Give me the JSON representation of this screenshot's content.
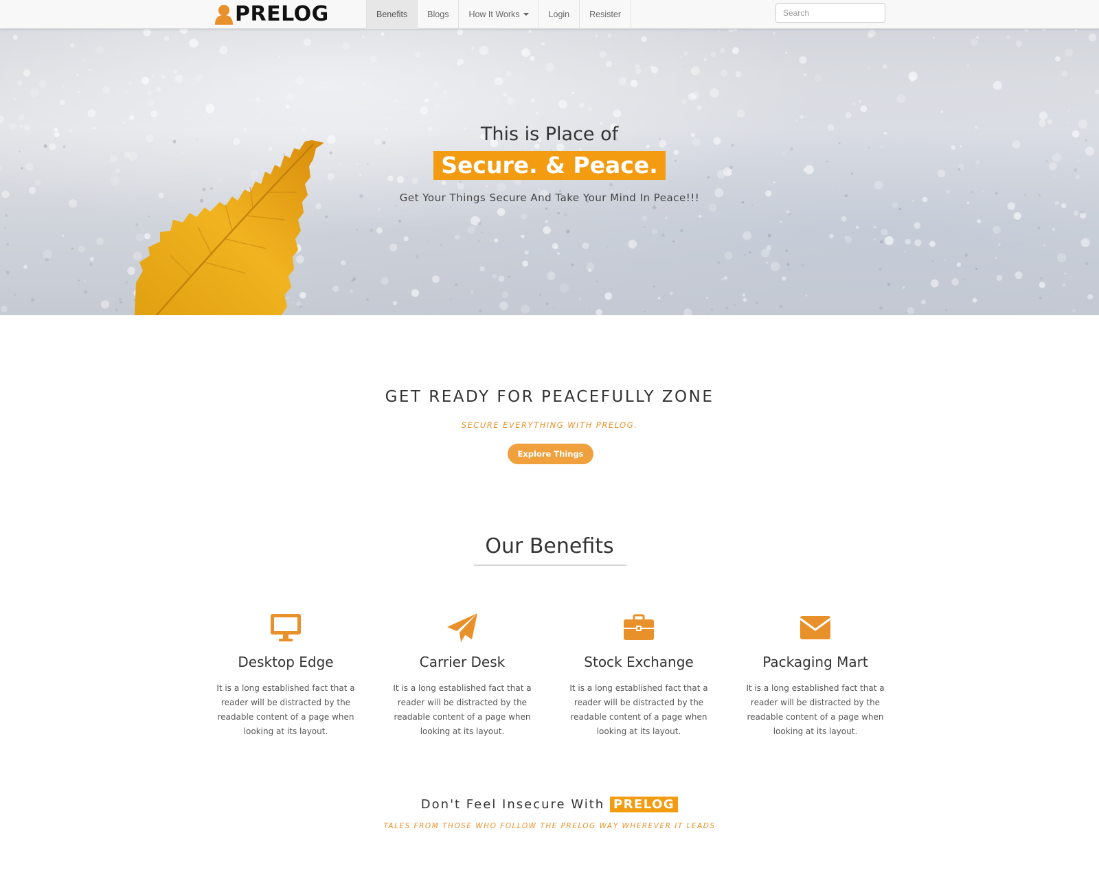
{
  "nav": {
    "brand": "PRELOG",
    "items": [
      {
        "label": "Benefits"
      },
      {
        "label": "Blogs"
      },
      {
        "label": "How It Works"
      },
      {
        "label": "Login"
      },
      {
        "label": "Resister"
      }
    ],
    "search_placeholder": "Search"
  },
  "hero": {
    "line1": "This is Place of",
    "highlight": "Secure. & Peace.",
    "subtitle": "Get Your Things Secure And Take Your Mind In Peace!!!"
  },
  "ready": {
    "title": "GET READY FOR PEACEFULLY ZONE",
    "subtitle": "SECURE EVERYTHING WITH PRELOG.",
    "button": "Explore Things"
  },
  "benefits": {
    "title": "Our Benefits",
    "items": [
      {
        "title": "Desktop Edge",
        "icon": "desktop-icon",
        "text": "It is a long established fact that a reader will be distracted by the readable content of a page when looking at its layout."
      },
      {
        "title": "Carrier Desk",
        "icon": "paper-plane-icon",
        "text": "It is a long established fact that a reader will be distracted by the readable content of a page when looking at its layout."
      },
      {
        "title": "Stock Exchange",
        "icon": "briefcase-icon",
        "text": "It is a long established fact that a reader will be distracted by the readable content of a page when looking at its layout."
      },
      {
        "title": "Packaging Mart",
        "icon": "envelope-icon",
        "text": "It is a long established fact that a reader will be distracted by the readable content of a page when looking at its layout."
      }
    ]
  },
  "testimonials": {
    "title_prefix": "Don't Feel Insecure With",
    "title_brand": "PRELOG",
    "subtitle": "TALES FROM THOSE WHO FOLLOW THE PRELOG WAY WHEREVER IT LEADS"
  },
  "colors": {
    "accent": "#f39c12",
    "accent_soft": "#f0a13e",
    "nav_bg": "#f8f8f8"
  }
}
